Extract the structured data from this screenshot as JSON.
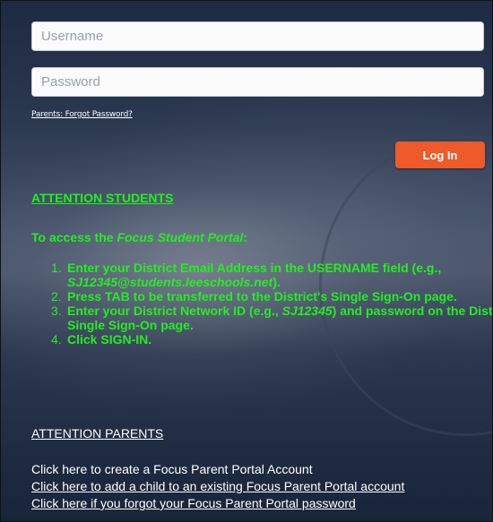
{
  "login": {
    "username_placeholder": "Username",
    "password_placeholder": "Password",
    "forgot_password": "Parents: Forgot Password?",
    "login_button": "Log In"
  },
  "students": {
    "heading": "ATTENTION STUDENTS",
    "intro_prefix": "To access the ",
    "intro_portal": "Focus Student Portal",
    "intro_suffix": ":",
    "steps": [
      {
        "num": "1.",
        "a": "Enter your District Email Address in the USERNAME field (e.g., ",
        "example": "SJ12345@students.leeschools.net",
        "b": ")."
      },
      {
        "num": "2.",
        "a": "Press TAB to be transferred to the District's Single Sign-On page."
      },
      {
        "num": "3.",
        "a": "Enter your District Network ID (e.g., ",
        "example": "SJ12345",
        "b": ") and password on the District's Single Sign-On page."
      },
      {
        "num": "4.",
        "a": "Click SIGN-IN."
      }
    ]
  },
  "parents": {
    "heading": "ATTENTION PARENTS",
    "links": [
      "Click here to create a Focus Parent Portal Account",
      "Click here to add a child to an existing Focus Parent Portal account",
      "Click here if you forgot your Focus Parent Portal password"
    ]
  },
  "colors": {
    "accent_green": "#22f01e",
    "login_button": "#ef5a2a"
  }
}
